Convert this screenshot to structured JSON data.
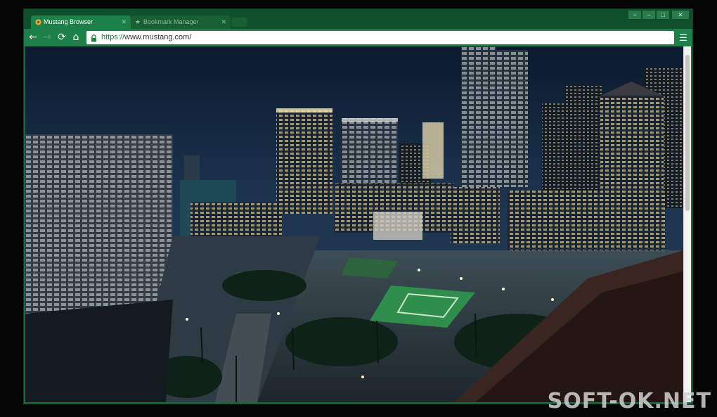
{
  "tabs": [
    {
      "label": "Mustang Browser",
      "active": true
    },
    {
      "label": "Bookmark Manager",
      "active": false
    }
  ],
  "window_controls": [
    "user",
    "minimize",
    "maximize",
    "close"
  ],
  "toolbar": {
    "back_icon": "back-arrow-icon",
    "forward_icon": "forward-arrow-icon",
    "reload_icon": "reload-icon",
    "home_icon": "home-icon",
    "menu_icon": "hamburger-menu-icon"
  },
  "address_bar": {
    "scheme": "https://",
    "rest": "www.mustang.com/"
  },
  "content": {
    "description_icon": "city-night-wallpaper-image"
  },
  "watermark": {
    "text": "SOFT-OK.NET"
  },
  "colors": {
    "frame": "#0f4f2b",
    "toolbar": "#1e8049",
    "accent_https": "#1a8a3a"
  }
}
